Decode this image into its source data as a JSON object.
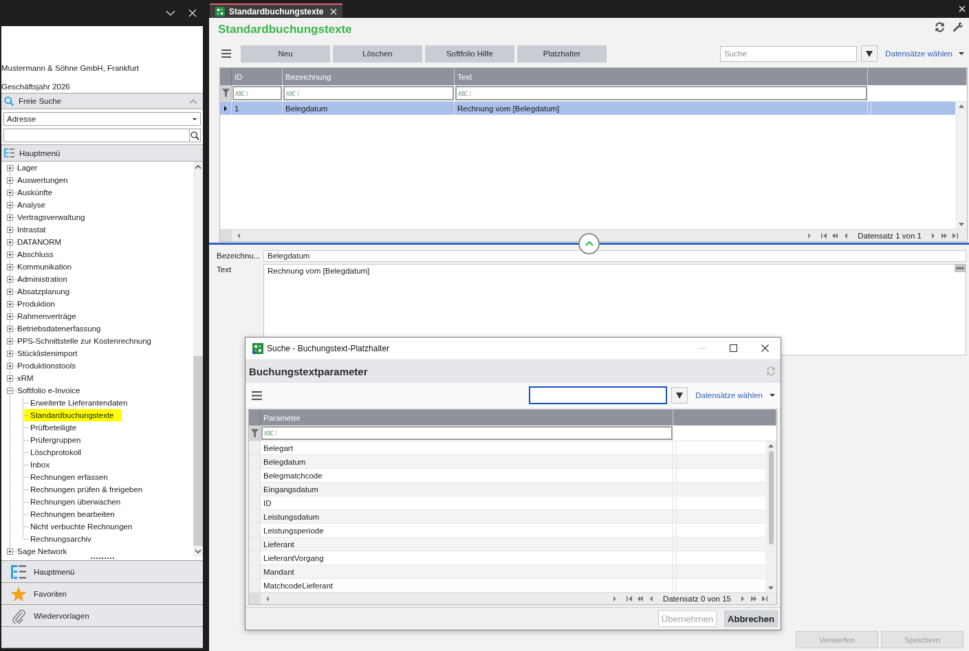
{
  "sidebar": {
    "company": "Mustermann & Söhne GmbH, Frankfurt",
    "fiscal_year": "Geschäftsjahr 2026",
    "search_section": {
      "title": "Freie Suche",
      "expanded": true,
      "category": "Adresse"
    },
    "menu_section": {
      "title": "Hauptmenü",
      "tree": [
        {
          "label": "Lager",
          "expanded": false,
          "selected": false
        },
        {
          "label": "Auswertungen",
          "expanded": false,
          "selected": false
        },
        {
          "label": "Auskünfte",
          "expanded": false,
          "selected": false
        },
        {
          "label": "Analyse",
          "expanded": false,
          "selected": false
        },
        {
          "label": "Vertragsverwaltung",
          "expanded": false,
          "selected": false
        },
        {
          "label": "Intrastat",
          "expanded": false,
          "selected": false
        },
        {
          "label": "DATANORM",
          "expanded": false,
          "selected": false
        },
        {
          "label": "Abschluss",
          "expanded": false,
          "selected": false
        },
        {
          "label": "Kommunikation",
          "expanded": false,
          "selected": false
        },
        {
          "label": "Administration",
          "expanded": false,
          "selected": false
        },
        {
          "label": "Absatzplanung",
          "expanded": false,
          "selected": false
        },
        {
          "label": "Produktion",
          "expanded": false,
          "selected": false
        },
        {
          "label": "Rahmenverträge",
          "expanded": false,
          "selected": false
        },
        {
          "label": "Betriebsdatenerfassung",
          "expanded": false,
          "selected": false
        },
        {
          "label": "PPS-Schnittstelle zur Kostenrechnung",
          "expanded": false,
          "selected": false
        },
        {
          "label": "Stücklistenimport",
          "expanded": false,
          "selected": false
        },
        {
          "label": "Produktionstools",
          "expanded": false,
          "selected": false
        },
        {
          "label": "xRM",
          "expanded": false,
          "selected": false
        },
        {
          "label": "Softfolio e-Invoice",
          "expanded": true,
          "selected": false,
          "children": [
            {
              "label": "Erweiterte Lieferantendaten",
              "selected": false
            },
            {
              "label": "Standardbuchungstexte",
              "selected": true
            },
            {
              "label": "Prüfbeteiligte",
              "selected": false
            },
            {
              "label": "Prüfergruppen",
              "selected": false
            },
            {
              "label": "Löschprotokoll",
              "selected": false
            },
            {
              "label": "Inbox",
              "selected": false
            },
            {
              "label": "Rechnungen erfassen",
              "selected": false
            },
            {
              "label": "Rechnungen prüfen & freigeben",
              "selected": false
            },
            {
              "label": "Rechnungen überwachen",
              "selected": false
            },
            {
              "label": "Rechnungen bearbeiten",
              "selected": false
            },
            {
              "label": "Nicht verbuchte Rechnungen",
              "selected": false
            },
            {
              "label": "Rechnungsarchiv",
              "selected": false
            }
          ]
        },
        {
          "label": "Sage Network",
          "expanded": false,
          "selected": false
        }
      ]
    },
    "nav_buttons": [
      "Hauptmenü",
      "Favoriten",
      "Wiedervorlagen"
    ]
  },
  "tabs": [
    {
      "label": "Standardbuchungstexte",
      "selected": true
    }
  ],
  "page": {
    "title": "Standardbuchungstexte",
    "toolbar": {
      "buttons": [
        "Neu",
        "Löschen",
        "Softfolio Hilfe",
        "Platzhalter"
      ],
      "search": {
        "placeholder": "Suche"
      },
      "records_link": "Datensätze wählen"
    },
    "grid": {
      "columns": [
        "ID",
        "Bezeichnung",
        "Text"
      ],
      "rows": [
        {
          "cells": [
            "1",
            "Belegdatum",
            "Rechnung vom [Belegdatum]"
          ],
          "selected": true
        }
      ],
      "pager": "Datensatz 1 von 1"
    },
    "form": {
      "fields": [
        {
          "kind": "line",
          "label": "Bezeichnu...",
          "value": "Belegdatum"
        },
        {
          "kind": "multiline",
          "label": "Text",
          "value": "Rechnung vom [Belegdatum]"
        }
      ]
    },
    "footer_buttons": [
      {
        "label": "Verwerfen",
        "disabled": true
      },
      {
        "label": "Speichern",
        "disabled": true
      }
    ]
  },
  "dialog": {
    "title": "Suche - Buchungstext-Platzhalter",
    "minimize_disabled": true,
    "heading": "Buchungstextparameter",
    "search": {
      "focused": true
    },
    "records_link": "Datensätze wählen",
    "grid": {
      "columns": [
        "Parameter"
      ],
      "rows": [
        {
          "label": "Belegart",
          "selected": false
        },
        {
          "label": "Belegdatum",
          "selected": false
        },
        {
          "label": "Belegmatchcode",
          "selected": false
        },
        {
          "label": "Eingangsdatum",
          "selected": false
        },
        {
          "label": "ID",
          "selected": false
        },
        {
          "label": "Leistungsdatum",
          "selected": false
        },
        {
          "label": "Leistungsperiode",
          "selected": false
        },
        {
          "label": "Lieferant",
          "selected": false
        },
        {
          "label": "LieferantVorgang",
          "selected": false
        },
        {
          "label": "Mandant",
          "selected": false
        },
        {
          "label": "MatchcodeLieferant",
          "selected": false
        }
      ],
      "pager": "Datensatz 0 von 15"
    },
    "buttons": [
      {
        "label": "Übernehmen",
        "disabled": true
      },
      {
        "label": "Abbrechen",
        "disabled": false
      }
    ]
  }
}
